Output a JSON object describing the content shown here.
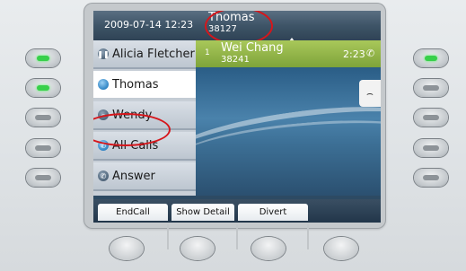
{
  "status_bar": {
    "datetime": "2009-07-14 12:23",
    "line_name": "Thomas",
    "line_number": "38127"
  },
  "line_keys": [
    {
      "label": "Alicia Fletcher",
      "icon": "pause-icon",
      "active": false
    },
    {
      "label": "Thomas",
      "icon": "line-icon",
      "active": true
    },
    {
      "label": "Wendy",
      "icon": "handset-icon",
      "active": false
    },
    {
      "label": "All Calls",
      "icon": "phone-icon",
      "active": false
    },
    {
      "label": "Answer",
      "icon": "answer-icon",
      "active": false
    }
  ],
  "active_call": {
    "index": "1",
    "name": "Wei Chang",
    "number": "38241",
    "duration": "2:23"
  },
  "softkeys": [
    {
      "label": "EndCall"
    },
    {
      "label": "Show Detail"
    },
    {
      "label": "Divert"
    }
  ],
  "colors": {
    "call_green": "#8fb348",
    "annotation_red": "#d6161b",
    "led_green": "#38d04a"
  }
}
